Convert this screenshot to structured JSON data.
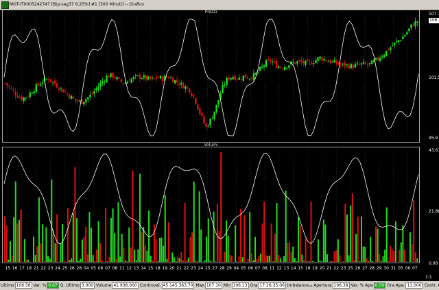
{
  "window": {
    "title": "MOT-IT0005242747 [Btp-sag37   6,25%] #1 [300 Minuti] -- Grafico"
  },
  "panels": {
    "price_title": "Prezzi",
    "volume_title": "Volumi"
  },
  "price_axis": {
    "top": "107.10",
    "current": "106.56",
    "mid": "101.5",
    "bottom": "95.9"
  },
  "volume_axis": {
    "top": "43.610.00",
    "mid": "21.867.40",
    "bottom": "0.00"
  },
  "x_labels": [
    "15",
    "16",
    "17",
    "18",
    "21",
    "22",
    "23",
    "24",
    "25",
    "26",
    "28",
    "04",
    "05",
    "06",
    "07",
    "08",
    "11",
    "12",
    "13",
    "14",
    "15",
    "18",
    "19",
    "20",
    "21",
    "22",
    "23",
    "24",
    "25",
    "27",
    "28",
    "29",
    "04",
    "05",
    "06",
    "07",
    "08",
    "11",
    "12",
    "13",
    "14",
    "15",
    "18",
    "19",
    "20",
    "21",
    "22",
    "23",
    "25",
    "26",
    "27",
    "28",
    "29",
    "30",
    "31",
    "05",
    "06",
    "07"
  ],
  "scale_label": "1:1",
  "colors": {
    "up": "#22dd22",
    "down": "#dd1111",
    "line": "#ffffff",
    "grid": "#3a3a3a"
  },
  "chart_data": [
    {
      "type": "candlestick",
      "title": "Prezzi",
      "ylim": [
        95.9,
        107.1
      ],
      "y_ticks": [
        "107.10",
        "106.56",
        "101.5",
        "95.9"
      ],
      "overlay_line": "white oscillator line (values not labeled)",
      "close_path": [
        101.0,
        100.5,
        100.0,
        99.6,
        99.8,
        100.3,
        100.8,
        101.2,
        101.4,
        101.0,
        100.6,
        100.2,
        99.8,
        99.4,
        99.3,
        99.6,
        100.0,
        100.6,
        101.2,
        101.7,
        101.6,
        101.2,
        101.0,
        101.3,
        101.5,
        101.6,
        101.4,
        101.3,
        101.5,
        101.4,
        101.6,
        101.3,
        101.0,
        100.7,
        100.4,
        99.5,
        98.2,
        97.0,
        97.8,
        99.0,
        100.5,
        101.4,
        101.6,
        101.4,
        101.6,
        101.5,
        101.7,
        102.2,
        102.8,
        103.0,
        102.6,
        102.4,
        102.6,
        102.8,
        102.9,
        102.8,
        102.7,
        103.0,
        103.3,
        103.1,
        102.9,
        102.8,
        102.6,
        102.6,
        102.5,
        102.6,
        102.7,
        102.6,
        102.9,
        103.3,
        103.7,
        104.2,
        104.6,
        105.0,
        105.5,
        106.2,
        106.56
      ]
    },
    {
      "type": "bar",
      "title": "Volumi",
      "ylim": [
        0,
        43610
      ],
      "y_ticks": [
        "43.610.00",
        "21.867.40",
        "0.00"
      ],
      "overlay_line": "white oscillator line (values not labeled)",
      "series_colors": [
        "green (up)",
        "red (down)"
      ]
    }
  ],
  "status": {
    "items": [
      {
        "label": "Ultimo",
        "value": "106.56",
        "green": false
      },
      {
        "label": "Var. %",
        "value": "0.67",
        "green": true
      },
      {
        "label": "Q. Ultimo",
        "value": "3.000",
        "green": false
      },
      {
        "label": "Volume",
        "value": "41.938.000",
        "green": false
      },
      {
        "label": "Controval.",
        "value": "45.145.363.70",
        "green": false
      },
      {
        "label": "Max",
        "value": "107.10",
        "green": false
      },
      {
        "label": "Min",
        "value": "106.13",
        "green": false
      },
      {
        "label": "Ora",
        "value": "17:26:35.06",
        "green": false
      },
      {
        "label": "Imbalance",
        "value": "",
        "green": false
      },
      {
        "label": "Apertura",
        "value": "106.38",
        "green": false
      },
      {
        "label": "Var. % Ape",
        "value": "0.50",
        "green": true
      },
      {
        "label": "Ora Ape.",
        "value": "11.000",
        "green": false
      },
      {
        "label": "Contr. Ape.",
        "value": "0",
        "green": false
      },
      {
        "label": "Teorico ch",
        "value": "",
        "green": false
      },
      {
        "label": "Scadenza",
        "value": "01/08/20",
        "green": false
      }
    ]
  }
}
